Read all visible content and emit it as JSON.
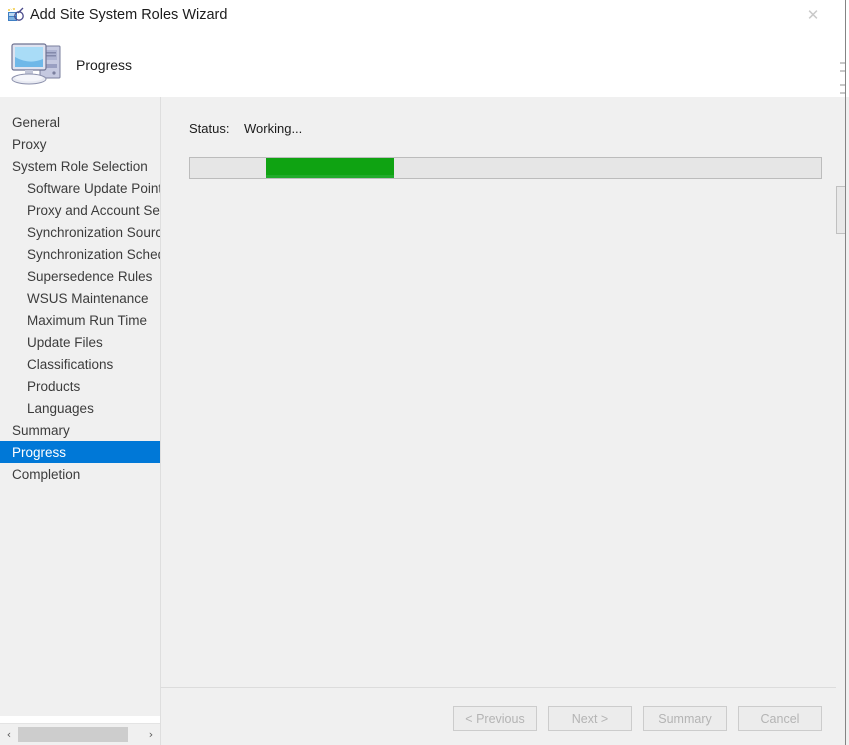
{
  "window": {
    "title": "Add Site System Roles Wizard",
    "title_icon": "wizard-icon",
    "close_label": "✕"
  },
  "header": {
    "icon": "computer-icon",
    "title": "Progress"
  },
  "sidebar": {
    "items": [
      {
        "label": "General",
        "level": 0,
        "selected": false
      },
      {
        "label": "Proxy",
        "level": 0,
        "selected": false
      },
      {
        "label": "System Role Selection",
        "level": 0,
        "selected": false
      },
      {
        "label": "Software Update Point",
        "level": 1,
        "selected": false
      },
      {
        "label": "Proxy and Account Settings",
        "level": 1,
        "selected": false
      },
      {
        "label": "Synchronization Source",
        "level": 1,
        "selected": false
      },
      {
        "label": "Synchronization Schedule",
        "level": 1,
        "selected": false
      },
      {
        "label": "Supersedence Rules",
        "level": 1,
        "selected": false
      },
      {
        "label": "WSUS Maintenance",
        "level": 1,
        "selected": false
      },
      {
        "label": "Maximum Run Time",
        "level": 1,
        "selected": false
      },
      {
        "label": "Update Files",
        "level": 1,
        "selected": false
      },
      {
        "label": "Classifications",
        "level": 1,
        "selected": false
      },
      {
        "label": "Products",
        "level": 1,
        "selected": false
      },
      {
        "label": "Languages",
        "level": 1,
        "selected": false
      },
      {
        "label": "Summary",
        "level": 0,
        "selected": false
      },
      {
        "label": "Progress",
        "level": 0,
        "selected": true
      },
      {
        "label": "Completion",
        "level": 0,
        "selected": false
      }
    ],
    "scrollbar": {
      "left_arrow": "‹",
      "right_arrow": "›"
    }
  },
  "content": {
    "status_label": "Status:",
    "status_value": "Working...",
    "progress": {
      "indeterminate": true,
      "fill_color": "#0fa312"
    }
  },
  "footer": {
    "buttons": [
      {
        "label": "< Previous",
        "enabled": false
      },
      {
        "label": "Next >",
        "enabled": false
      },
      {
        "label": "Summary",
        "enabled": false
      },
      {
        "label": "Cancel",
        "enabled": false
      }
    ]
  },
  "colors": {
    "selection_blue": "#0078d7",
    "progress_green": "#0fa312",
    "panel_gray": "#f0f0f0"
  }
}
